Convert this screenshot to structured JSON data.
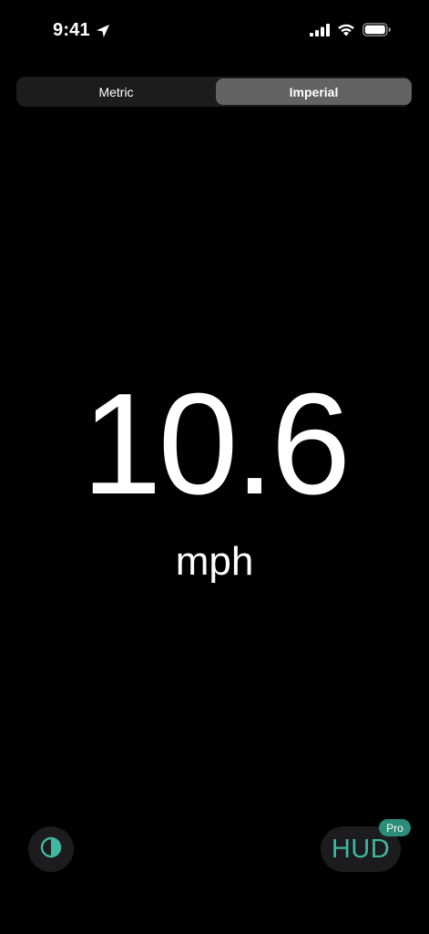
{
  "status_bar": {
    "time": "9:41",
    "icons": [
      "location-arrow-icon",
      "cellular-signal-icon",
      "wifi-icon",
      "battery-icon"
    ]
  },
  "unit_selector": {
    "options": [
      "Metric",
      "Imperial"
    ],
    "selected": "Imperial"
  },
  "speed": {
    "value": "10.6",
    "unit": "mph"
  },
  "bottom_bar": {
    "theme_toggle_icon": "contrast-icon",
    "hud_label": "HUD",
    "pro_badge": "Pro"
  },
  "colors": {
    "background": "#000000",
    "segmented_background": "#1c1c1e",
    "segment_selected": "#636366",
    "accent_teal": "#3fb8a0",
    "pro_badge": "#2a8c79",
    "text": "#ffffff"
  }
}
